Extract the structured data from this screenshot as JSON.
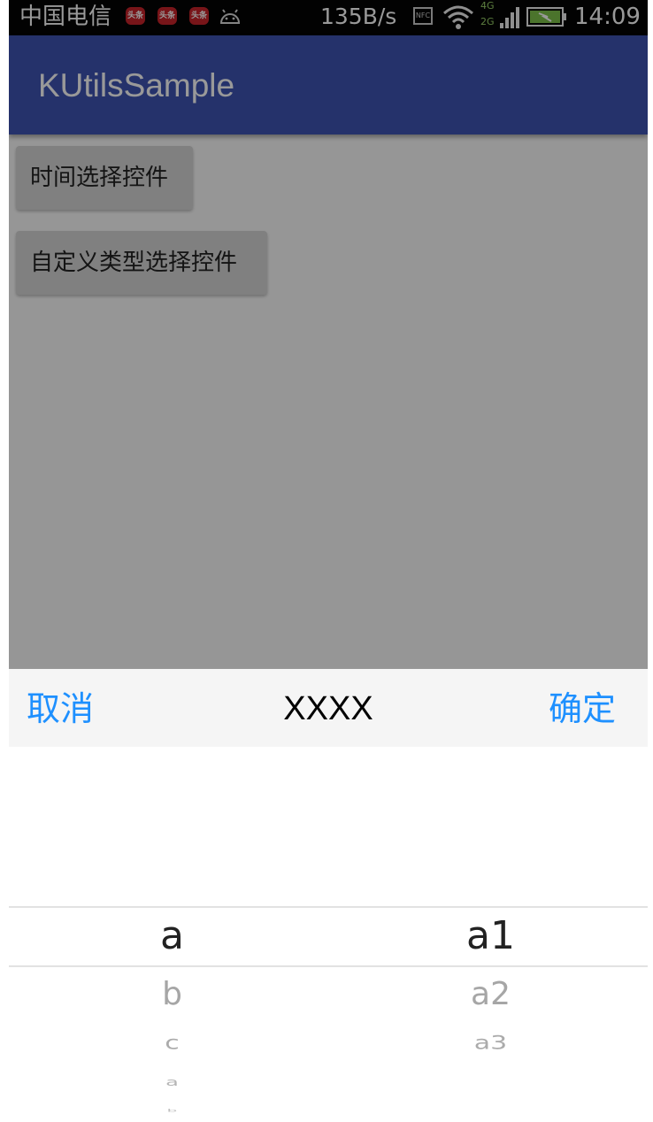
{
  "status_bar": {
    "carrier": "中国电信",
    "badges": [
      "头条",
      "头条",
      "头条"
    ],
    "net_speed": "135B/s",
    "nfc": "NFC",
    "net_label_top": "4G",
    "net_label_bottom": "2G",
    "time": "14:09"
  },
  "app_bar": {
    "title": "KUtilsSample"
  },
  "buttons": {
    "time_picker": "时间选择控件",
    "custom_type_picker": "自定义类型选择控件"
  },
  "picker": {
    "cancel_label": "取消",
    "title": "XXXX",
    "confirm_label": "确定",
    "left_column": [
      "a",
      "b",
      "c",
      "a",
      "b"
    ],
    "right_column": [
      "a1",
      "a2",
      "a3"
    ]
  },
  "colors": {
    "app_bar": "#3f54b3",
    "accent": "#1e90ff",
    "status_bar": "#040404"
  }
}
